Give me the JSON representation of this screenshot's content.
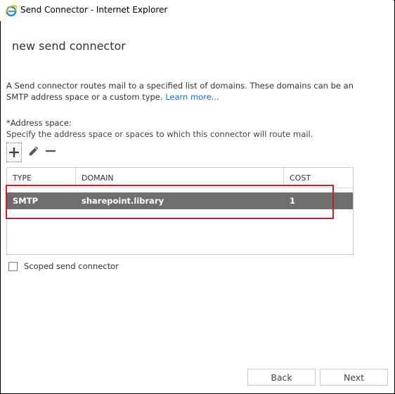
{
  "window": {
    "title": "Send Connector - Internet Explorer",
    "icon": "internet-explorer-icon"
  },
  "page": {
    "title": "new send connector",
    "description": "A Send connector routes mail to a specified list of domains. These domains can be an SMTP address space or a custom type.",
    "learn_more": "Learn more..."
  },
  "address_space": {
    "label": "*Address space:",
    "help": "Specify the address space or spaces to which this connector will route mail.",
    "toolbar": {
      "add_icon": "plus-icon",
      "edit_icon": "pencil-icon",
      "remove_icon": "minus-icon"
    },
    "columns": [
      "TYPE",
      "DOMAIN",
      "COST"
    ],
    "rows": [
      {
        "type": "SMTP",
        "domain": "sharepoint.library",
        "cost": "1",
        "selected": true
      }
    ]
  },
  "scoped": {
    "label": "Scoped send connector",
    "checked": false
  },
  "buttons": {
    "back": "Back",
    "next": "Next"
  },
  "colors": {
    "selected_row": "#6e6e6e",
    "highlight_box": "#c8202a",
    "link": "#1f6fbf"
  }
}
